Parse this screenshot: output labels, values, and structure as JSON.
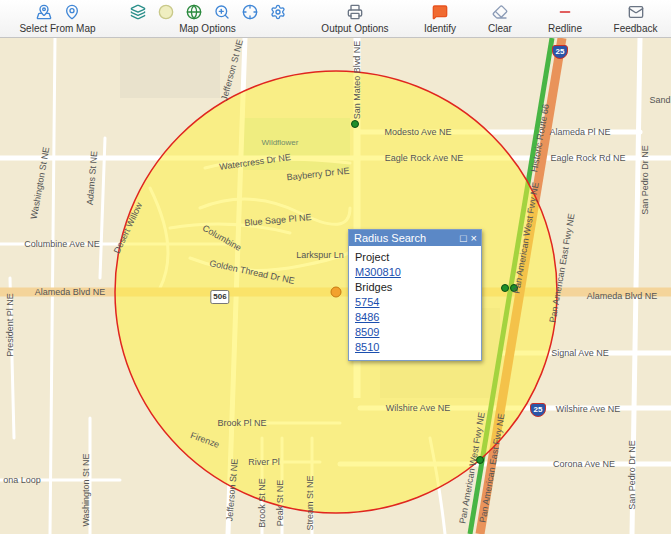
{
  "toolbar": {
    "groups": [
      {
        "label": "Select From Map"
      },
      {
        "label": "Map Options"
      },
      {
        "label": "Output Options"
      },
      {
        "label": "Identify"
      },
      {
        "label": "Clear"
      },
      {
        "label": "Redline"
      },
      {
        "label": "Feedback"
      }
    ]
  },
  "map": {
    "street_labels": [
      "Jefferson St NE",
      "San Mateo Blvd NE",
      "Modesto Ave NE",
      "Alameda Pl NE",
      "Sand",
      "Watercress Dr NE",
      "Bayberry Dr NE",
      "Eagle Rock Ave NE",
      "Eagle Rock Rd NE",
      "Washington St NE",
      "Adams St NE",
      "Desert Willow",
      "Blue Sage Pl NE",
      "Columbine",
      "Columbine Ave NE",
      "Golden Thread Dr NE",
      "Larkspur Ln",
      "Alameda Blvd NE",
      "Alameda Blvd NE",
      "Signal Ave NE",
      "President Pl NE",
      "Wilshire Ave NE",
      "Wilshire Ave NE",
      "Brook Pl NE",
      "Firenze",
      "River Pl",
      "Corona Ave NE",
      "ona Loop",
      "Washington St NE",
      "Jefferson St NE",
      "Brook St NE",
      "Peak St NE",
      "Stream St NE",
      "Historic Route 66",
      "Pan American West Fwy NE",
      "Pan American East Fwy NE",
      "Pan American West Fwy NE",
      "Pan American East Fwy NE",
      "San Pedro Dr NE",
      "San Pedro Dr NE"
    ],
    "park_labels": [
      "Wildflower"
    ],
    "route_shields": [
      {
        "label": "506",
        "kind": "state"
      },
      {
        "label": "25",
        "kind": "interstate"
      },
      {
        "label": "25",
        "kind": "interstate"
      }
    ]
  },
  "popup": {
    "title": "Radius Search",
    "controls": [
      "□",
      "×"
    ],
    "sections": [
      {
        "heading": "Project",
        "links": [
          "M300810"
        ]
      },
      {
        "heading": "Bridges",
        "links": [
          "5754",
          "8486",
          "8509",
          "8510"
        ]
      }
    ]
  }
}
